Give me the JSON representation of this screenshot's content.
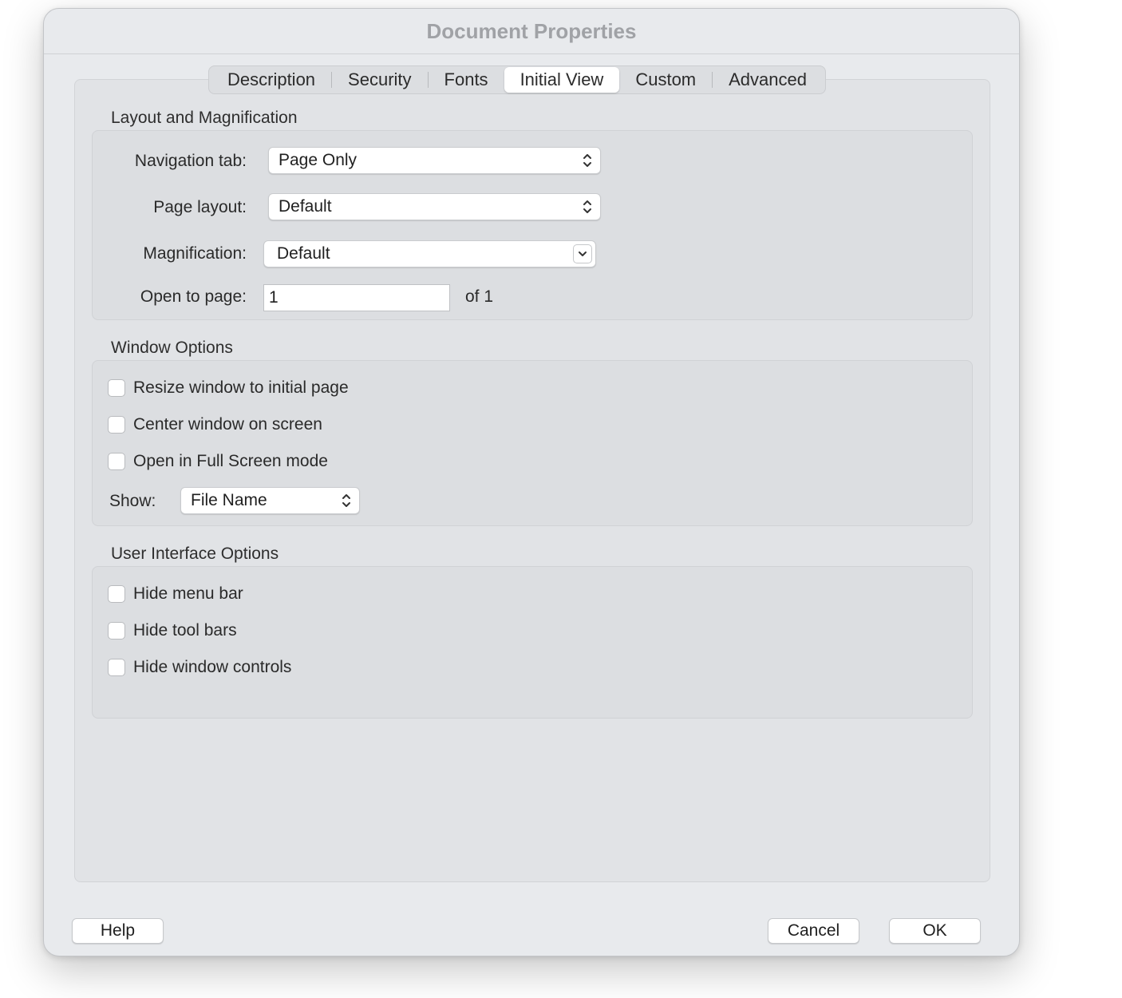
{
  "window": {
    "title": "Document Properties"
  },
  "tabs": [
    {
      "label": "Description"
    },
    {
      "label": "Security"
    },
    {
      "label": "Fonts"
    },
    {
      "label": "Initial View",
      "active": true
    },
    {
      "label": "Custom"
    },
    {
      "label": "Advanced"
    }
  ],
  "layout_magnification": {
    "heading": "Layout and Magnification",
    "navigation_tab": {
      "label": "Navigation tab:",
      "value": "Page Only"
    },
    "page_layout": {
      "label": "Page layout:",
      "value": "Default"
    },
    "magnification": {
      "label": "Magnification:",
      "value": "Default"
    },
    "open_to_page": {
      "label": "Open to page:",
      "value": "1",
      "of_text": "of 1"
    }
  },
  "window_options": {
    "heading": "Window Options",
    "checkboxes": [
      {
        "label": "Resize window to initial page",
        "checked": false
      },
      {
        "label": "Center window on screen",
        "checked": false
      },
      {
        "label": "Open in Full Screen mode",
        "checked": false
      }
    ],
    "show": {
      "label": "Show:",
      "value": "File Name"
    }
  },
  "ui_options": {
    "heading": "User Interface Options",
    "checkboxes": [
      {
        "label": "Hide menu bar",
        "checked": false
      },
      {
        "label": "Hide tool bars",
        "checked": false
      },
      {
        "label": "Hide window controls",
        "checked": false
      }
    ]
  },
  "buttons": {
    "help": "Help",
    "cancel": "Cancel",
    "ok": "OK"
  },
  "colors": {
    "window_bg": "#e8eaed",
    "group_bg": "#dcdee1",
    "title_text": "#a0a2a6"
  },
  "icons": {
    "popup": "up-down-chevron-icon",
    "combo": "chevron-down-icon"
  }
}
